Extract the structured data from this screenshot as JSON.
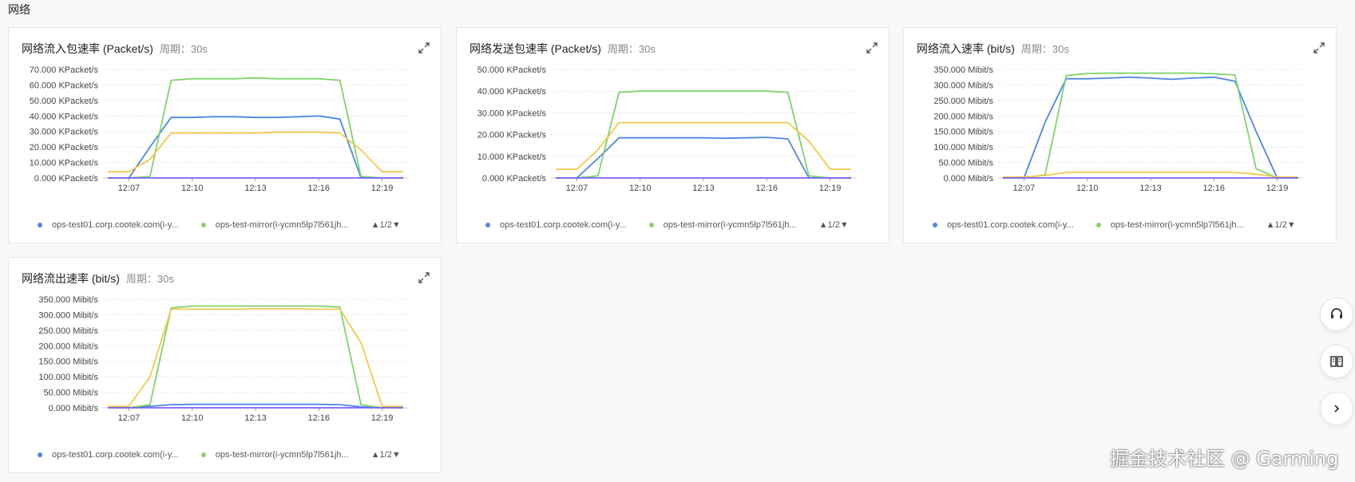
{
  "section_title": "网络",
  "period_label": "周期：30s",
  "legend": {
    "series1": "ops-test01.corp.cootek.com(i-y...",
    "series2": "ops-test-mirror(i-ycmn5lp7l561jh...",
    "pager": "▲1/2▼"
  },
  "colors": {
    "blue": "#4e86e4",
    "green": "#7ed36b",
    "yellow": "#f2c94c",
    "purple": "#7b61ff"
  },
  "watermark": "掘金技术社区 @ Garming",
  "cards": [
    {
      "title": "网络流入包速率 (Packet/s)",
      "y_ticks": [
        "70.000 KPacket/s",
        "60.000 KPacket/s",
        "50.000 KPacket/s",
        "40.000 KPacket/s",
        "30.000 KPacket/s",
        "20.000 KPacket/s",
        "10.000 KPacket/s",
        "0.000 KPacket/s"
      ],
      "x_ticks": [
        "12:07",
        "12:10",
        "12:13",
        "12:16",
        "12:19"
      ]
    },
    {
      "title": "网络发送包速率 (Packet/s)",
      "y_ticks": [
        "50.000 KPacket/s",
        "40.000 KPacket/s",
        "30.000 KPacket/s",
        "20.000 KPacket/s",
        "10.000 KPacket/s",
        "0.000 KPacket/s"
      ],
      "x_ticks": [
        "12:07",
        "12:10",
        "12:13",
        "12:16",
        "12:19"
      ]
    },
    {
      "title": "网络流入速率 (bit/s)",
      "y_ticks": [
        "350.000 Mibit/s",
        "300.000 Mibit/s",
        "250.000 Mibit/s",
        "200.000 Mibit/s",
        "150.000 Mibit/s",
        "100.000 Mibit/s",
        "50.000 Mibit/s",
        "0.000 Mibit/s"
      ],
      "x_ticks": [
        "12:07",
        "12:10",
        "12:13",
        "12:16",
        "12:19"
      ]
    },
    {
      "title": "网络流出速率 (bit/s)",
      "y_ticks": [
        "350.000 Mibit/s",
        "300.000 Mibit/s",
        "250.000 Mibit/s",
        "200.000 Mibit/s",
        "150.000 Mibit/s",
        "100.000 Mibit/s",
        "50.000 Mibit/s",
        "0.000 Mibit/s"
      ],
      "x_ticks": [
        "12:07",
        "12:10",
        "12:13",
        "12:16",
        "12:19"
      ]
    }
  ],
  "chart_data": [
    {
      "type": "line",
      "title": "网络流入包速率 (Packet/s)",
      "ylabel": "KPacket/s",
      "ylim": [
        0,
        70
      ],
      "x": [
        "12:06",
        "12:07",
        "12:08",
        "12:09",
        "12:10",
        "12:11",
        "12:12",
        "12:13",
        "12:14",
        "12:15",
        "12:16",
        "12:17",
        "12:18",
        "12:19",
        "12:20"
      ],
      "series": [
        {
          "color": "#4e86e4",
          "values": [
            0,
            0,
            20,
            39,
            39,
            39.5,
            39.5,
            39,
            39,
            39.5,
            40,
            38,
            0,
            0,
            0
          ]
        },
        {
          "color": "#7ed36b",
          "values": [
            0,
            0,
            1,
            63,
            64,
            64,
            64,
            64.5,
            64,
            64,
            64,
            63,
            1,
            0,
            0
          ]
        },
        {
          "color": "#f2c94c",
          "values": [
            4,
            4,
            12,
            29,
            29,
            29,
            29,
            29,
            29.5,
            29.5,
            29.5,
            29,
            18,
            4,
            4
          ]
        },
        {
          "color": "#7b61ff",
          "values": [
            0,
            0,
            0,
            0,
            0,
            0,
            0,
            0,
            0,
            0,
            0,
            0,
            0,
            0,
            0
          ]
        }
      ]
    },
    {
      "type": "line",
      "title": "网络发送包速率 (Packet/s)",
      "ylabel": "KPacket/s",
      "ylim": [
        0,
        50
      ],
      "x": [
        "12:06",
        "12:07",
        "12:08",
        "12:09",
        "12:10",
        "12:11",
        "12:12",
        "12:13",
        "12:14",
        "12:15",
        "12:16",
        "12:17",
        "12:18",
        "12:19",
        "12:20"
      ],
      "series": [
        {
          "color": "#4e86e4",
          "values": [
            0,
            0,
            9,
            18.5,
            18.5,
            18.5,
            18.5,
            18.5,
            18.3,
            18.5,
            18.7,
            18,
            0,
            0,
            0
          ]
        },
        {
          "color": "#7ed36b",
          "values": [
            0,
            0,
            1,
            39.5,
            40,
            40,
            40,
            40,
            40,
            40,
            40,
            39.5,
            1,
            0,
            0
          ]
        },
        {
          "color": "#f2c94c",
          "values": [
            4,
            4,
            13,
            25.5,
            25.5,
            25.5,
            25.5,
            25.5,
            25.5,
            25.5,
            25.5,
            25.5,
            17,
            4,
            4
          ]
        },
        {
          "color": "#7b61ff",
          "values": [
            0,
            0,
            0,
            0,
            0,
            0,
            0,
            0,
            0,
            0,
            0,
            0,
            0,
            0,
            0
          ]
        }
      ]
    },
    {
      "type": "line",
      "title": "网络流入速率 (bit/s)",
      "ylabel": "Mibit/s",
      "ylim": [
        0,
        350
      ],
      "x": [
        "12:06",
        "12:07",
        "12:08",
        "12:09",
        "12:10",
        "12:11",
        "12:12",
        "12:13",
        "12:14",
        "12:15",
        "12:16",
        "12:17",
        "12:18",
        "12:19",
        "12:20"
      ],
      "series": [
        {
          "color": "#4e86e4",
          "values": [
            0,
            0,
            180,
            320,
            320,
            322,
            325,
            322,
            318,
            322,
            325,
            312,
            150,
            0,
            0
          ]
        },
        {
          "color": "#7ed36b",
          "values": [
            0,
            0,
            10,
            330,
            337,
            338,
            338,
            338,
            338,
            338,
            336,
            332,
            30,
            0,
            0
          ]
        },
        {
          "color": "#f2c94c",
          "values": [
            3,
            3,
            8,
            18,
            18,
            18,
            18,
            18,
            18,
            18,
            18,
            18,
            12,
            3,
            3
          ]
        },
        {
          "color": "#7b61ff",
          "values": [
            0,
            0,
            0,
            0,
            0,
            0,
            0,
            0,
            0,
            0,
            0,
            0,
            0,
            0,
            0
          ]
        }
      ]
    },
    {
      "type": "line",
      "title": "网络流出速率 (bit/s)",
      "ylabel": "Mibit/s",
      "ylim": [
        0,
        350
      ],
      "x": [
        "12:06",
        "12:07",
        "12:08",
        "12:09",
        "12:10",
        "12:11",
        "12:12",
        "12:13",
        "12:14",
        "12:15",
        "12:16",
        "12:17",
        "12:18",
        "12:19",
        "12:20"
      ],
      "series": [
        {
          "color": "#4e86e4",
          "values": [
            0,
            0,
            5,
            10,
            11,
            11,
            11,
            11,
            11,
            11,
            11,
            10,
            3,
            0,
            0
          ]
        },
        {
          "color": "#7ed36b",
          "values": [
            0,
            0,
            10,
            322,
            328,
            328,
            328,
            328,
            328,
            328,
            328,
            325,
            10,
            0,
            0
          ]
        },
        {
          "color": "#f2c94c",
          "values": [
            5,
            5,
            100,
            318,
            318,
            318,
            318,
            319,
            319,
            319,
            318,
            318,
            210,
            5,
            5
          ]
        },
        {
          "color": "#7b61ff",
          "values": [
            0,
            0,
            0,
            0,
            0,
            0,
            0,
            0,
            0,
            0,
            0,
            0,
            0,
            0,
            0
          ]
        }
      ]
    }
  ]
}
